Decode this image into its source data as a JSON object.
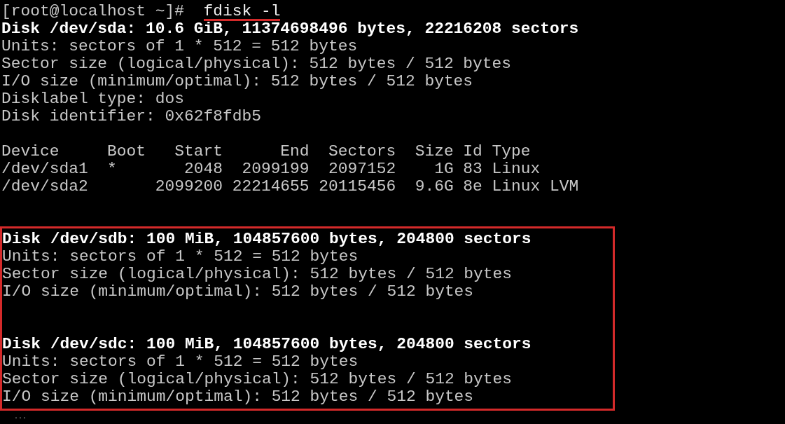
{
  "prompt": {
    "text": "[root@localhost ~]#",
    "command": "fdisk -l",
    "underlined": true
  },
  "sections": [
    {
      "kind": "plain",
      "lines": [
        {
          "kind": "header",
          "text": "Disk /dev/sda: 10.6 GiB, 11374698496 bytes, 22216208 sectors"
        },
        {
          "kind": "plain",
          "text": "Units: sectors of 1 * 512 = 512 bytes"
        },
        {
          "kind": "plain",
          "text": "Sector size (logical/physical): 512 bytes / 512 bytes"
        },
        {
          "kind": "plain",
          "text": "I/O size (minimum/optimal): 512 bytes / 512 bytes"
        },
        {
          "kind": "plain",
          "text": "Disklabel type: dos"
        },
        {
          "kind": "plain",
          "text": "Disk identifier: 0x62f8fdb5"
        },
        {
          "kind": "blank"
        },
        {
          "kind": "plain",
          "text": "Device     Boot   Start      End  Sectors  Size Id Type"
        },
        {
          "kind": "plain",
          "text": "/dev/sda1  *       2048  2099199  2097152    1G 83 Linux"
        },
        {
          "kind": "plain",
          "text": "/dev/sda2       2099200 22214655 20115456  9.6G 8e Linux LVM"
        },
        {
          "kind": "blank"
        },
        {
          "kind": "blank"
        }
      ]
    },
    {
      "kind": "boxed",
      "lines": [
        {
          "kind": "header",
          "text": "Disk /dev/sdb: 100 MiB, 104857600 bytes, 204800 sectors"
        },
        {
          "kind": "plain",
          "text": "Units: sectors of 1 * 512 = 512 bytes"
        },
        {
          "kind": "plain",
          "text": "Sector size (logical/physical): 512 bytes / 512 bytes"
        },
        {
          "kind": "plain",
          "text": "I/O size (minimum/optimal): 512 bytes / 512 bytes"
        },
        {
          "kind": "blank"
        },
        {
          "kind": "blank"
        },
        {
          "kind": "header",
          "text": "Disk /dev/sdc: 100 MiB, 104857600 bytes, 204800 sectors"
        },
        {
          "kind": "plain",
          "text": "Units: sectors of 1 * 512 = 512 bytes"
        },
        {
          "kind": "plain",
          "text": "Sector size (logical/physical): 512 bytes / 512 bytes"
        },
        {
          "kind": "plain",
          "text": "I/O size (minimum/optimal): 512 bytes / 512 bytes"
        }
      ]
    }
  ],
  "cursor": "..."
}
